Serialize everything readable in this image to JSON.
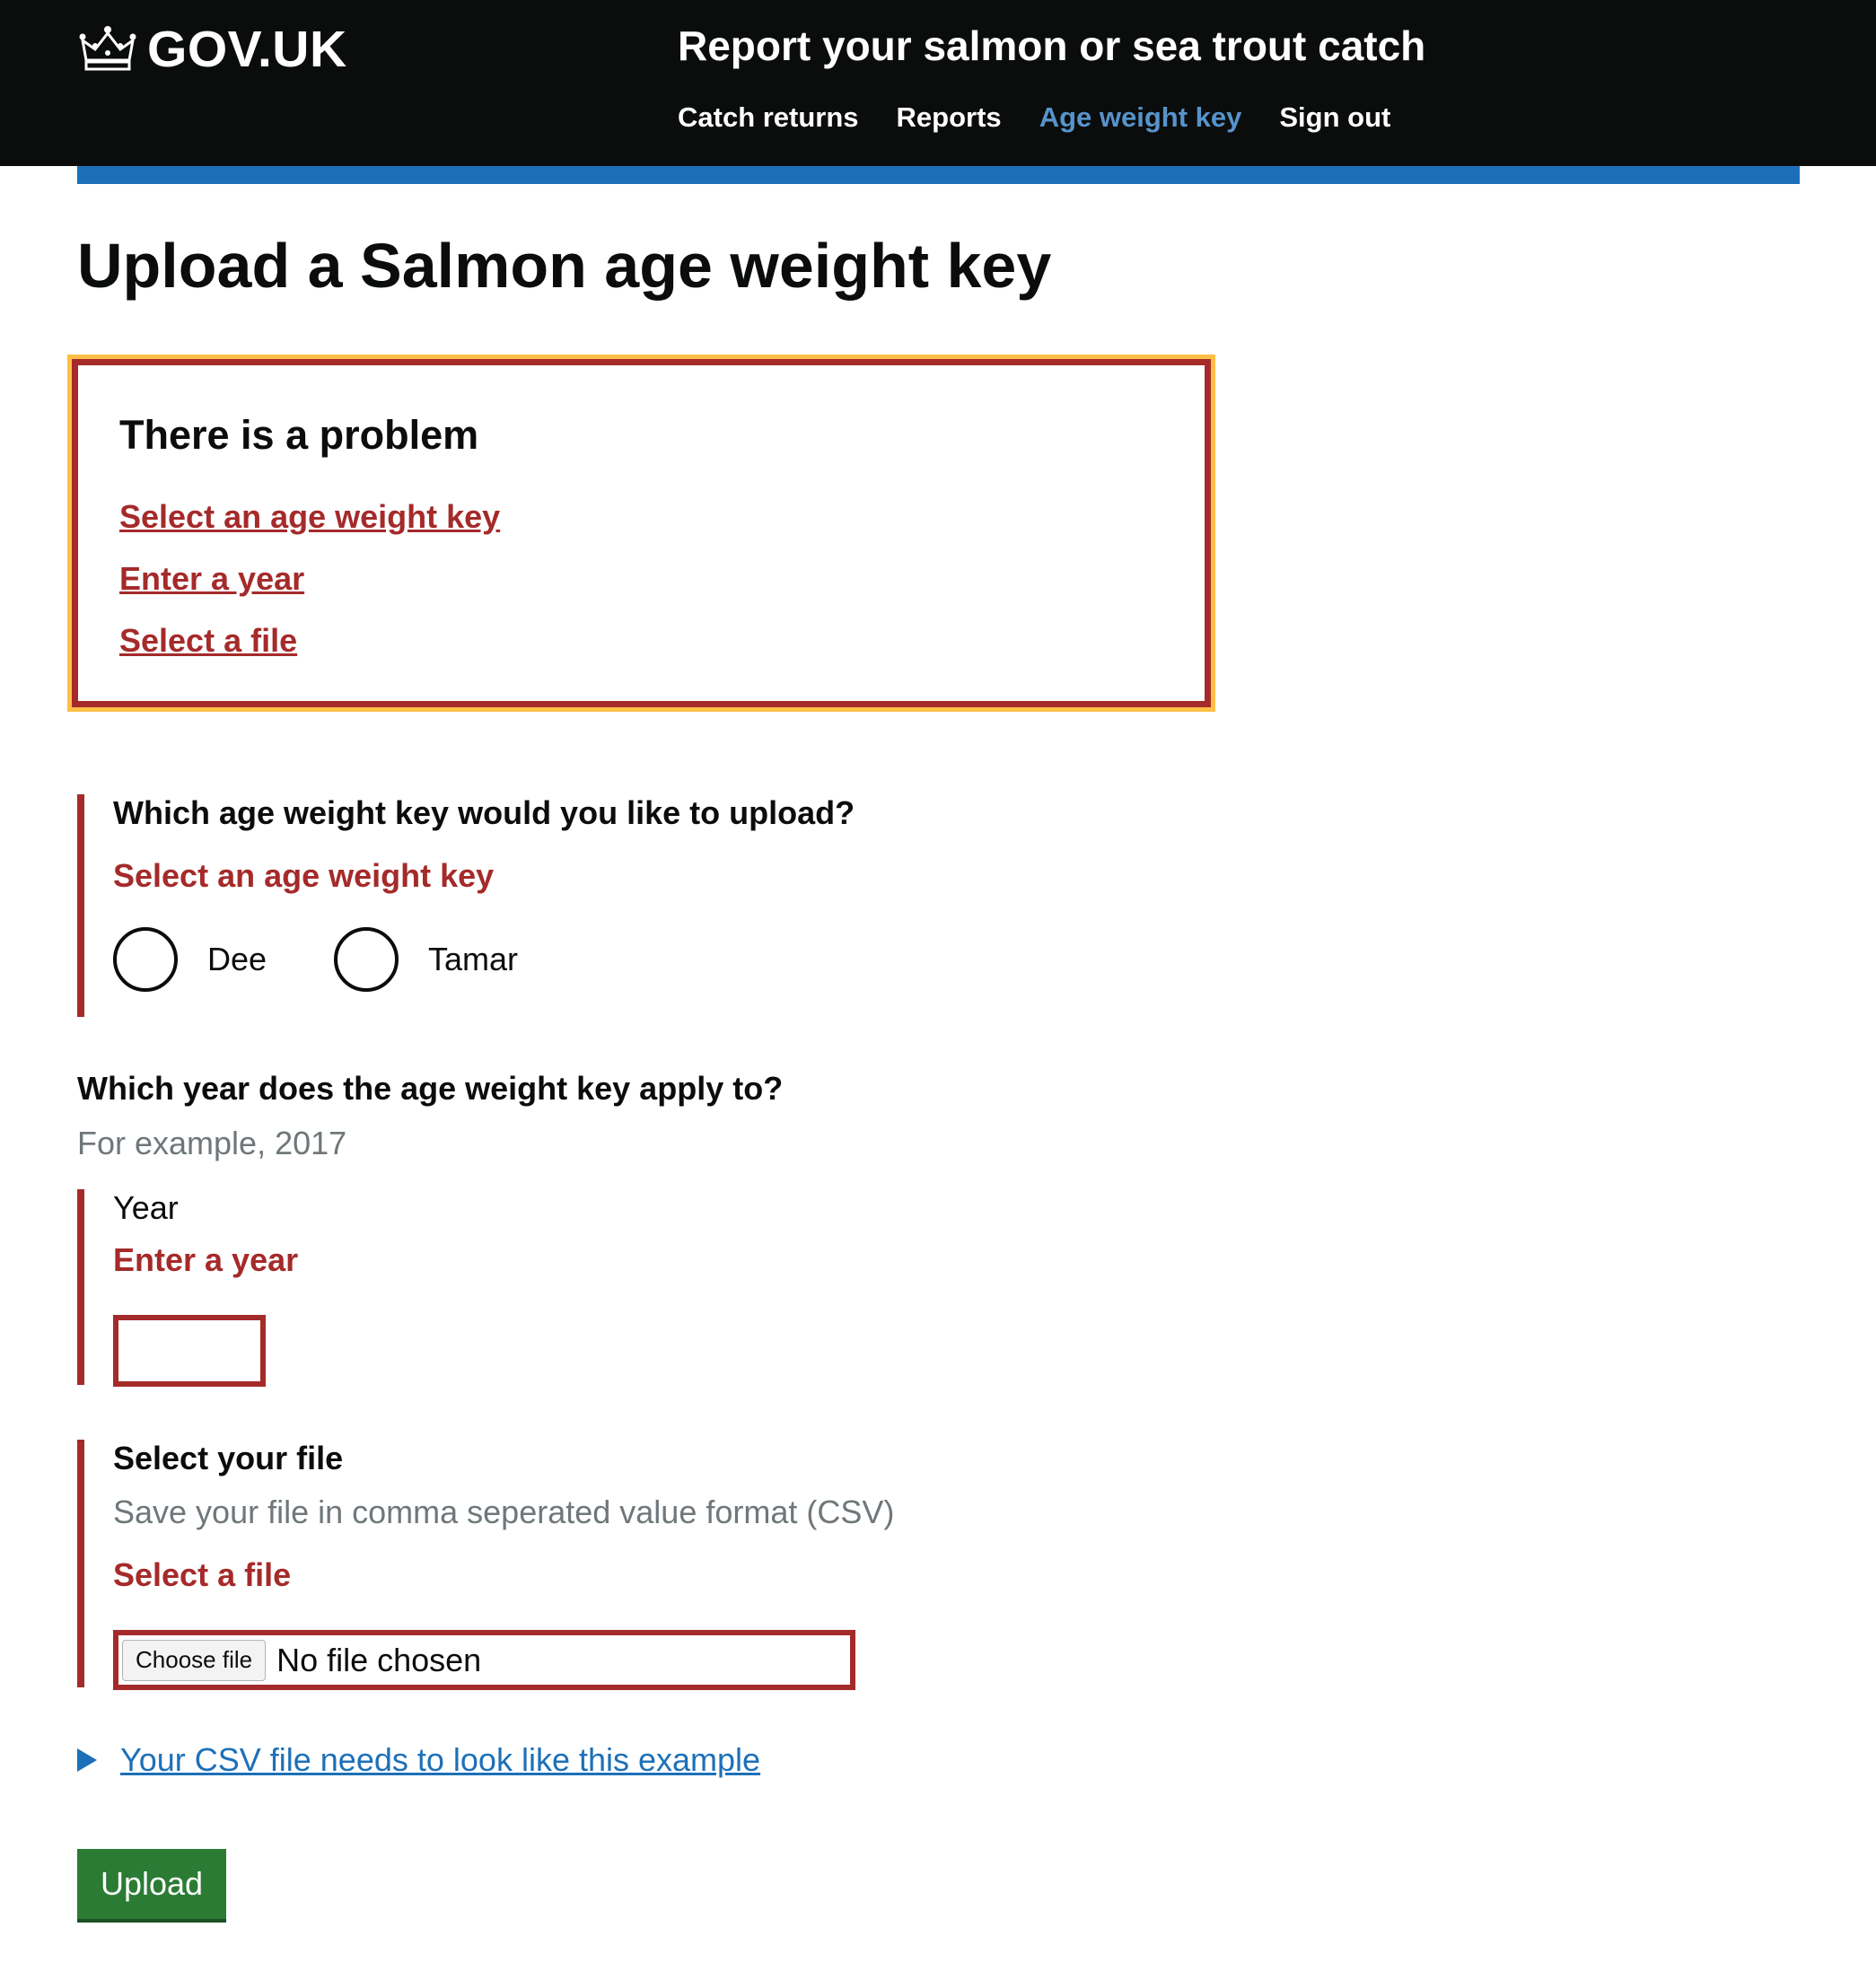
{
  "header": {
    "logo_text": "GOV.UK",
    "logo_icon": "crown-icon",
    "service_name": "Report your salmon or sea trout catch",
    "nav": [
      {
        "label": "Catch returns",
        "active": false
      },
      {
        "label": "Reports",
        "active": false
      },
      {
        "label": "Age weight key",
        "active": true
      },
      {
        "label": "Sign out",
        "active": false
      }
    ]
  },
  "page": {
    "title": "Upload a Salmon age weight key"
  },
  "error_summary": {
    "title": "There is a problem",
    "errors": [
      "Select an age weight key",
      "Enter a year",
      "Select a file"
    ]
  },
  "age_weight_key": {
    "question": "Which age weight key would you like to upload?",
    "error": "Select an age weight key",
    "options": [
      "Dee",
      "Tamar"
    ]
  },
  "year": {
    "question": "Which year does the age weight key apply to?",
    "hint": "For example, 2017",
    "label": "Year",
    "error": "Enter a year",
    "value": ""
  },
  "file": {
    "question": "Select your file",
    "hint": "Save your file in comma seperated value format (CSV)",
    "error": "Select a file",
    "button_label": "Choose file",
    "status": "No file chosen"
  },
  "details": {
    "summary": "Your CSV file needs to look like this example"
  },
  "actions": {
    "upload_label": "Upload"
  },
  "colors": {
    "header_bg": "#0b0c0c",
    "blue_bar": "#1d70b8",
    "error_red": "#a52a2a",
    "focus_yellow": "#ffbf47",
    "active_nav": "#5694ca",
    "link_blue": "#1d70b8",
    "button_green": "#2b7b34",
    "hint_grey": "#6f777b"
  }
}
